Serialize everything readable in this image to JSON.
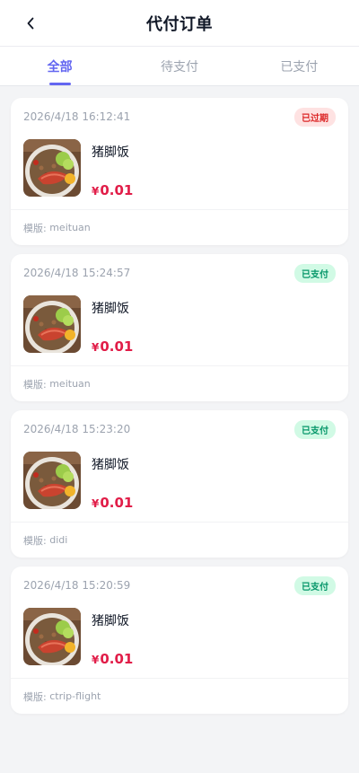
{
  "header": {
    "title": "代付订单",
    "back_icon": "chevron-left-icon"
  },
  "tabs": [
    {
      "label": "全部",
      "active": true
    },
    {
      "label": "待支付",
      "active": false
    },
    {
      "label": "已支付",
      "active": false
    }
  ],
  "orders": [
    {
      "time": "2026/4/18 16:12:41",
      "status": "已过期",
      "status_type": "expired",
      "product": "猪脚饭",
      "currency": "¥",
      "price": "0.01",
      "template_label": "模版:",
      "template": "meituan"
    },
    {
      "time": "2026/4/18 15:24:57",
      "status": "已支付",
      "status_type": "paid",
      "product": "猪脚饭",
      "currency": "¥",
      "price": "0.01",
      "template_label": "模版:",
      "template": "meituan"
    },
    {
      "time": "2026/4/18 15:23:20",
      "status": "已支付",
      "status_type": "paid",
      "product": "猪脚饭",
      "currency": "¥",
      "price": "0.01",
      "template_label": "模版:",
      "template": "didi"
    },
    {
      "time": "2026/4/18 15:20:59",
      "status": "已支付",
      "status_type": "paid",
      "product": "猪脚饭",
      "currency": "¥",
      "price": "0.01",
      "template_label": "模版:",
      "template": "ctrip-flight"
    }
  ],
  "colors": {
    "accent": "#6366f1",
    "price": "#e11d48",
    "expired": "#dc2626",
    "paid": "#059669"
  }
}
